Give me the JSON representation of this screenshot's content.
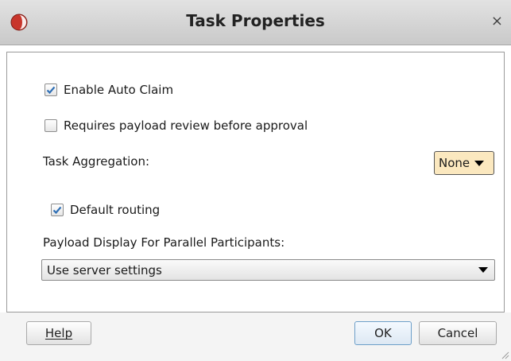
{
  "window": {
    "title": "Task Properties",
    "close_symbol": "×",
    "app_icon": "oracle-jdeveloper-icon"
  },
  "options": {
    "enable_auto_claim": {
      "label": "Enable Auto Claim",
      "checked": true
    },
    "requires_payload_review": {
      "label": "Requires payload review before approval",
      "checked": false
    },
    "task_aggregation": {
      "label": "Task Aggregation:",
      "value": "None"
    },
    "default_routing": {
      "label": "Default routing",
      "checked": true
    },
    "payload_display": {
      "label": "Payload Display For Parallel Participants:",
      "value": "Use server settings"
    }
  },
  "buttons": {
    "help": "Help",
    "ok": "OK",
    "cancel": "Cancel"
  },
  "colors": {
    "check_accent": "#2f6fb5",
    "dropdown_highlight": "#fbe8bf"
  }
}
